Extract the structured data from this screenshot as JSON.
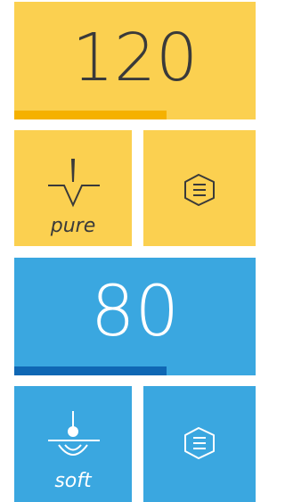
{
  "panels": [
    {
      "value": "120",
      "level": 0.63,
      "mode_label": "pure",
      "mode_icon": "pure-waveform-icon",
      "menu_icon": "menu-list-icon",
      "colors": {
        "tile": "#FBD050",
        "bar": "#F5B100",
        "text": "#3a3a3a"
      }
    },
    {
      "value": "80",
      "level": 0.63,
      "mode_label": "soft",
      "mode_icon": "soft-coagulation-icon",
      "menu_icon": "menu-list-icon",
      "colors": {
        "tile": "#3AA7E0",
        "bar": "#0F67B4",
        "text": "#ffffff"
      }
    }
  ]
}
